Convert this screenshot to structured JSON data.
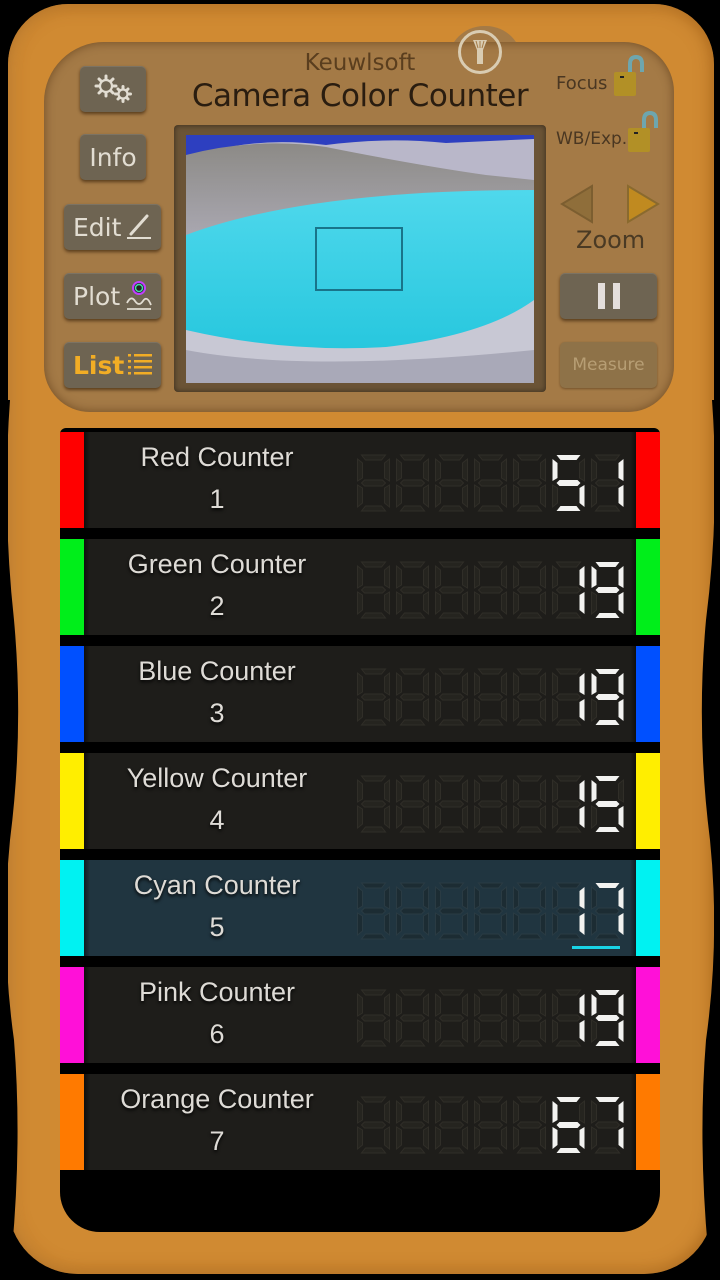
{
  "header": {
    "brand": "Keuwlsoft",
    "title": "Camera Color Counter"
  },
  "left_buttons": {
    "settings_icon": "gears-icon",
    "info": "Info",
    "edit": "Edit",
    "plot": "Plot",
    "list": "List"
  },
  "right_controls": {
    "focus_label": "Focus",
    "focus_lock": "unlocked",
    "wb_label": "WB/Exp.",
    "wb_lock": "unlocked",
    "zoom_label": "Zoom",
    "pause_icon": "pause-icon",
    "measure": "Measure"
  },
  "colors": {
    "frame": "#d08a32",
    "panel": "#a47a46",
    "list_active": "#f2ad25",
    "selected_row": "#203540",
    "cyan_underline": "#19d3e6"
  },
  "counters": [
    {
      "name": "Red Counter",
      "index": "1",
      "value": "51",
      "color": "#ff0000",
      "selected": false
    },
    {
      "name": "Green Counter",
      "index": "2",
      "value": "19",
      "color": "#00ee1a",
      "selected": false
    },
    {
      "name": "Blue Counter",
      "index": "3",
      "value": "19",
      "color": "#0050ff",
      "selected": false
    },
    {
      "name": "Yellow Counter",
      "index": "4",
      "value": "15",
      "color": "#ffee00",
      "selected": false
    },
    {
      "name": "Cyan Counter",
      "index": "5",
      "value": "17",
      "color": "#00f2f2",
      "selected": true
    },
    {
      "name": "Pink Counter",
      "index": "6",
      "value": "19",
      "color": "#ff10d8",
      "selected": false
    },
    {
      "name": "Orange Counter",
      "index": "7",
      "value": "67",
      "color": "#ff7a00",
      "selected": false
    }
  ]
}
